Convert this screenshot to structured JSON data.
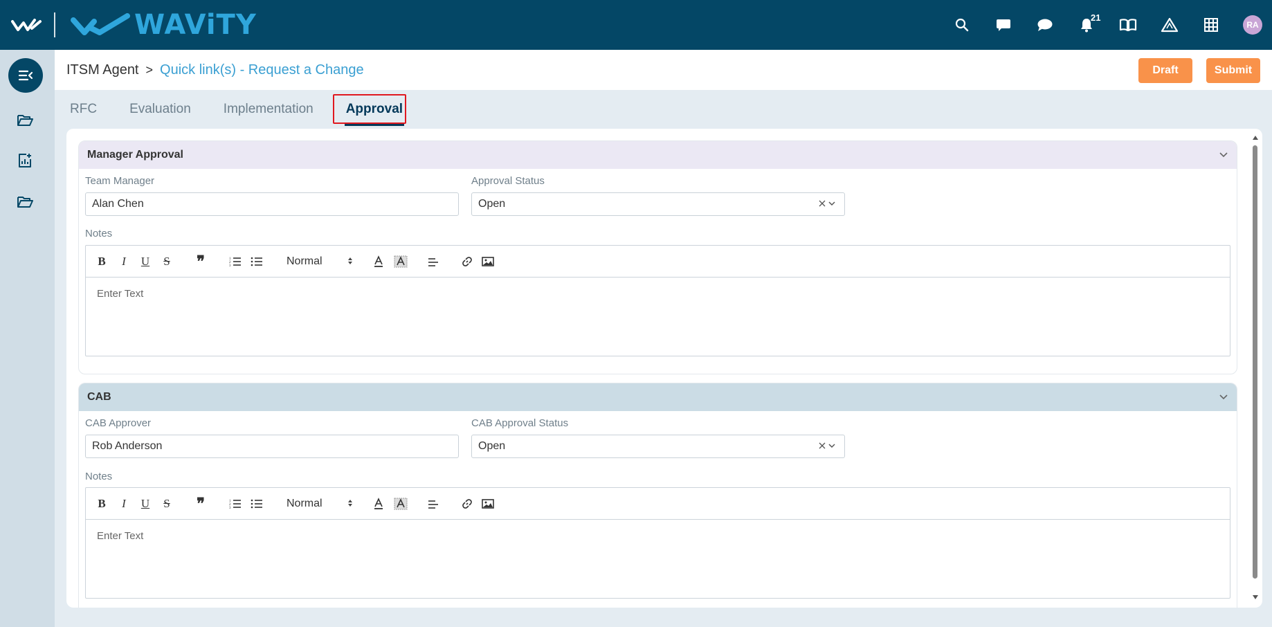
{
  "app": {
    "brand": "WAViTY",
    "notification_count": "21",
    "avatar_initials": "RA",
    "colors": {
      "topbar": "#044766",
      "accent": "#3a9fd2",
      "button": "#f9924a",
      "tab_active": "#04395a"
    }
  },
  "topbar": {
    "icons": [
      "search-icon",
      "message-square-icon",
      "chat-bubble-icon",
      "bell-icon",
      "book-icon",
      "alert-triangle-icon",
      "grid-icon"
    ]
  },
  "sidebar": {
    "items": [
      "menu-collapse-icon",
      "folder-open-icon",
      "report-add-icon",
      "folder-open-icon"
    ]
  },
  "header": {
    "crumb_root": "ITSM Agent",
    "crumb_sep": ">",
    "crumb_current": "Quick link(s) - Request a Change",
    "draft_label": "Draft",
    "submit_label": "Submit"
  },
  "tabs": [
    {
      "label": "RFC"
    },
    {
      "label": "Evaluation"
    },
    {
      "label": "Implementation"
    },
    {
      "label": "Approval",
      "active": true
    }
  ],
  "manager": {
    "title": "Manager Approval",
    "manager_label": "Team Manager",
    "manager_value": "Alan Chen",
    "status_label": "Approval Status",
    "status_value": "Open",
    "notes_label": "Notes",
    "font_size": "Normal",
    "notes_placeholder": "Enter Text"
  },
  "cab": {
    "title": "CAB",
    "approver_label": "CAB Approver",
    "approver_value": "Rob Anderson",
    "status_label": "CAB Approval Status",
    "status_value": "Open",
    "notes_label": "Notes",
    "font_size": "Normal",
    "notes_placeholder": "Enter Text"
  }
}
